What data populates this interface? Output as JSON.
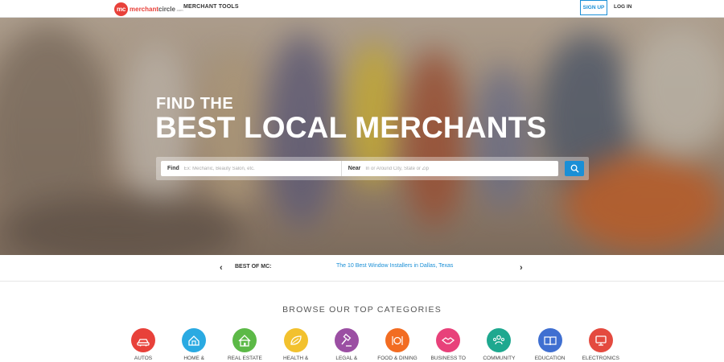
{
  "header": {
    "logo_mark": "mc",
    "logo_name_a": "merchant",
    "logo_name_b": "circle",
    "logo_tld": ".com",
    "nav_tools": "MERCHANT TOOLS",
    "signup": "SIGN UP",
    "login": "LOG IN"
  },
  "hero": {
    "title_line1": "FIND THE",
    "title_line2": "BEST LOCAL MERCHANTS",
    "find_label": "Find",
    "find_placeholder": "Ex: Mechanic, Beauty Salon, etc.",
    "near_label": "Near",
    "near_placeholder": "In or Around City, State or Zip",
    "search_icon": "search-icon"
  },
  "best_of": {
    "label": "BEST OF MC:",
    "link": "The 10 Best Window Installers in Dallas, Texas"
  },
  "categories": {
    "title": "BROWSE OUR TOP CATEGORIES",
    "items": [
      {
        "label": "AUTOS",
        "color": "#e8413a",
        "icon": "car-icon"
      },
      {
        "label": "HOME &",
        "color": "#2aaae2",
        "icon": "home-icon"
      },
      {
        "label": "REAL ESTATE",
        "color": "#5cb947",
        "icon": "house-icon"
      },
      {
        "label": "HEALTH &",
        "color": "#f2c12e",
        "icon": "leaf-icon"
      },
      {
        "label": "LEGAL &",
        "color": "#9b4fa3",
        "icon": "gavel-icon"
      },
      {
        "label": "FOOD & DINING",
        "color": "#f26c22",
        "icon": "dining-icon"
      },
      {
        "label": "BUSINESS TO",
        "color": "#e8417a",
        "icon": "handshake-icon"
      },
      {
        "label": "COMMUNITY",
        "color": "#1ea88f",
        "icon": "people-icon"
      },
      {
        "label": "EDUCATION",
        "color": "#3f6fd1",
        "icon": "book-icon"
      },
      {
        "label": "ELECTRONICS",
        "color": "#e44a3f",
        "icon": "monitor-icon"
      }
    ]
  }
}
